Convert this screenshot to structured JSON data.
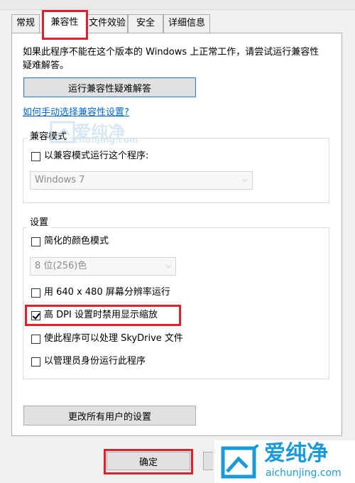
{
  "tabs": [
    {
      "label": "常规"
    },
    {
      "label": "兼容性"
    },
    {
      "label": "文件效验"
    },
    {
      "label": "安全"
    },
    {
      "label": "详细信息"
    }
  ],
  "intro_text": "如果此程序不能在这个版本的 Windows 上正常工作，请尝试运行兼容性疑难解答。",
  "troubleshoot_button": "运行兼容性疑难解答",
  "manual_link": "如何手动选择兼容性设置?",
  "compat_mode": {
    "title": "兼容模式",
    "checkbox_label": "以兼容模式运行这个程序:",
    "checked": false,
    "select_value": "Windows 7"
  },
  "settings": {
    "title": "设置",
    "reduced_color": {
      "label": "简化的颜色模式",
      "checked": false
    },
    "color_select_value": "8 位(256)色",
    "res_640": {
      "label": "用 640 x 480 屏幕分辨率运行",
      "checked": false
    },
    "dpi": {
      "label": "高 DPI 设置时禁用显示缩放",
      "checked": true
    },
    "skydrive": {
      "label": "使此程序可以处理 SkyDrive 文件",
      "checked": false
    },
    "admin": {
      "label": "以管理员身份运行此程序",
      "checked": false
    }
  },
  "all_users_button": "更改所有用户的设置",
  "ok_button": "确定",
  "watermark": {
    "brand": "爱纯净",
    "url": "aichunjing.com",
    "url_faint": "chunjing.com"
  },
  "colors": {
    "highlight": "#e0202a",
    "link": "#0066cc",
    "logo": "#1a9ad6"
  }
}
